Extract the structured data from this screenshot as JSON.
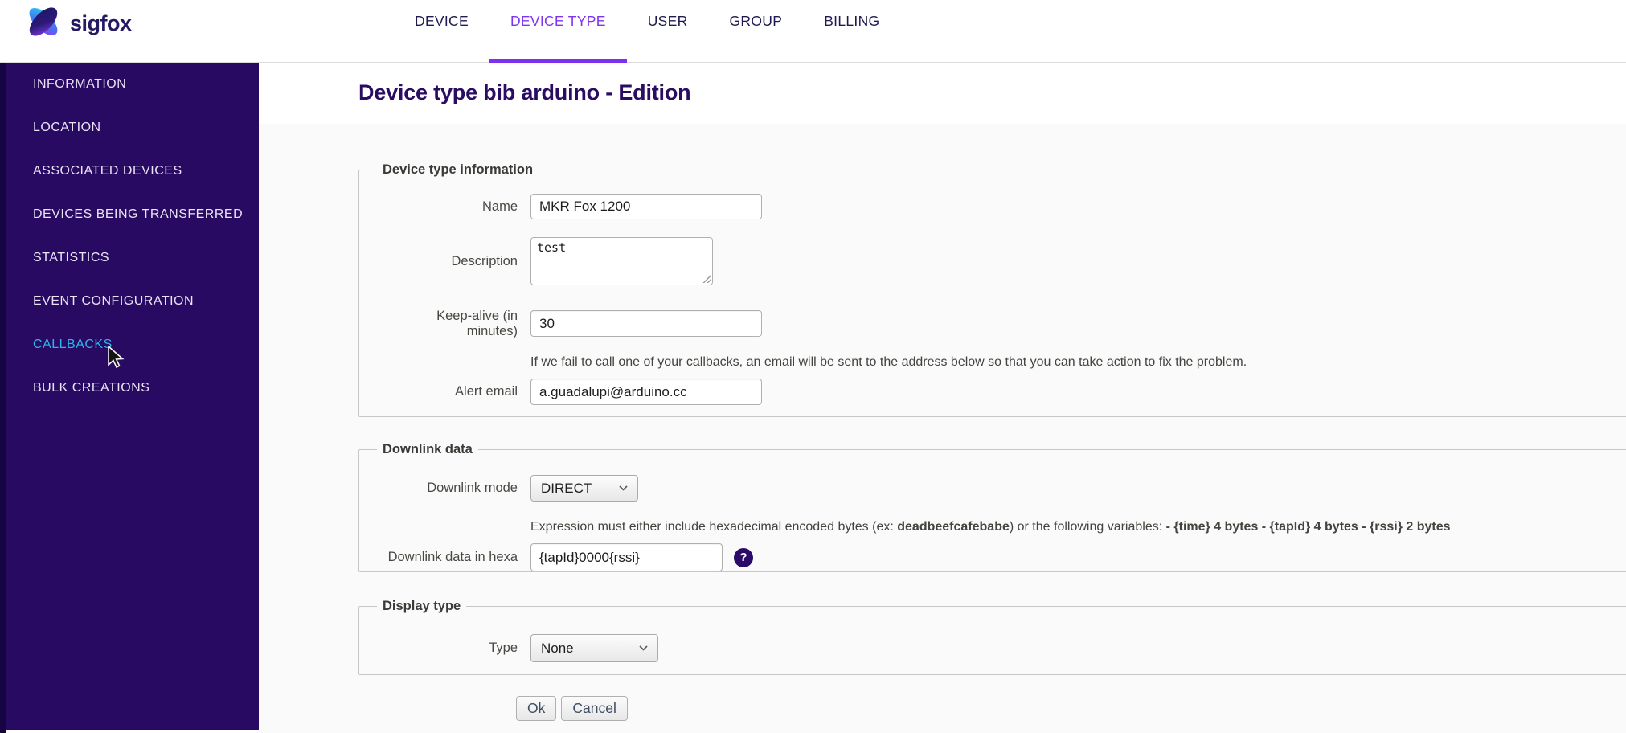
{
  "brand": {
    "name": "sigfox"
  },
  "nav": {
    "items": [
      {
        "label": "DEVICE",
        "active": false
      },
      {
        "label": "DEVICE TYPE",
        "active": true
      },
      {
        "label": "USER",
        "active": false
      },
      {
        "label": "GROUP",
        "active": false
      },
      {
        "label": "BILLING",
        "active": false
      }
    ]
  },
  "sidebar": {
    "items": [
      {
        "label": "INFORMATION",
        "highlight": false
      },
      {
        "label": "LOCATION",
        "highlight": false
      },
      {
        "label": "ASSOCIATED DEVICES",
        "highlight": false
      },
      {
        "label": "DEVICES BEING TRANSFERRED",
        "highlight": false
      },
      {
        "label": "STATISTICS",
        "highlight": false
      },
      {
        "label": "EVENT CONFIGURATION",
        "highlight": false
      },
      {
        "label": "CALLBACKS",
        "highlight": true
      },
      {
        "label": "BULK CREATIONS",
        "highlight": false
      }
    ]
  },
  "page": {
    "title": "Device type bib arduino - Edition"
  },
  "form": {
    "device_info": {
      "legend": "Device type information",
      "name": {
        "label": "Name",
        "value": "MKR Fox 1200"
      },
      "description": {
        "label": "Description",
        "value": "test"
      },
      "keepalive": {
        "label": "Keep-alive (in minutes)",
        "value": "30"
      },
      "alert_note": "If we fail to call one of your callbacks, an email will be sent to the address below so that you can take action to fix the problem.",
      "alert_email": {
        "label": "Alert email",
        "value": "a.guadalupi@arduino.cc"
      }
    },
    "downlink": {
      "legend": "Downlink data",
      "mode": {
        "label": "Downlink mode",
        "value": "DIRECT"
      },
      "expression_note": {
        "part1": "Expression must either include hexadecimal encoded bytes (ex: ",
        "bold1": "deadbeefcafebabe",
        "part2": ") or the following variables: ",
        "bold2": "- {time} 4 bytes - {tapId} 4 bytes - {rssi} 2 bytes"
      },
      "hexa": {
        "label": "Downlink data in hexa",
        "value": "{tapId}0000{rssi}"
      },
      "help_icon": "?"
    },
    "display": {
      "legend": "Display type",
      "type": {
        "label": "Type",
        "value": "None"
      }
    },
    "actions": {
      "ok": "Ok",
      "cancel": "Cancel"
    }
  },
  "colors": {
    "accent_purple": "#7e2ff0",
    "sidebar_bg": "#290a63",
    "sidebar_highlight": "#2fb3ec",
    "title_indigo": "#2a0c63",
    "help_icon_bg": "#2c0b68"
  }
}
